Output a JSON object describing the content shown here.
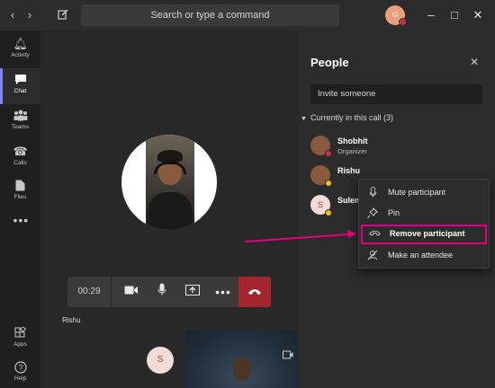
{
  "search": {
    "placeholder": "Search or type a command"
  },
  "rail": {
    "items": [
      {
        "label": "Activity",
        "icon": "bell-icon"
      },
      {
        "label": "Chat",
        "icon": "chat-icon"
      },
      {
        "label": "Teams",
        "icon": "teams-icon"
      },
      {
        "label": "Calls",
        "icon": "phone-icon"
      },
      {
        "label": "Files",
        "icon": "file-icon"
      }
    ],
    "bottom": [
      {
        "label": "Apps",
        "icon": "apps-icon"
      },
      {
        "label": "Help",
        "icon": "help-icon"
      }
    ]
  },
  "call": {
    "timer": "00:29",
    "stage_name": "Rishu",
    "self_initial": "S"
  },
  "people": {
    "title": "People",
    "invite_placeholder": "Invite someone",
    "section": "Currently in this call (3)",
    "participants": [
      {
        "name": "Shobhit",
        "role": "Organizer",
        "status_color": "#c4314b"
      },
      {
        "name": "Rishu",
        "role": "",
        "status_color": "#fbbc05"
      },
      {
        "name": "Sulem",
        "role": "",
        "initial": "S",
        "status_color": "#fbbc05"
      }
    ]
  },
  "menu": {
    "items": [
      {
        "label": "Mute participant",
        "icon": "microphone-icon"
      },
      {
        "label": "Pin",
        "icon": "pin-icon"
      },
      {
        "label": "Remove participant",
        "icon": "hangup-icon",
        "highlighted": true
      },
      {
        "label": "Make an attendee",
        "icon": "attendee-icon"
      }
    ]
  },
  "colors": {
    "accent": "#7f85f5",
    "hangup": "#a4262c",
    "highlight": "#e6007e"
  }
}
